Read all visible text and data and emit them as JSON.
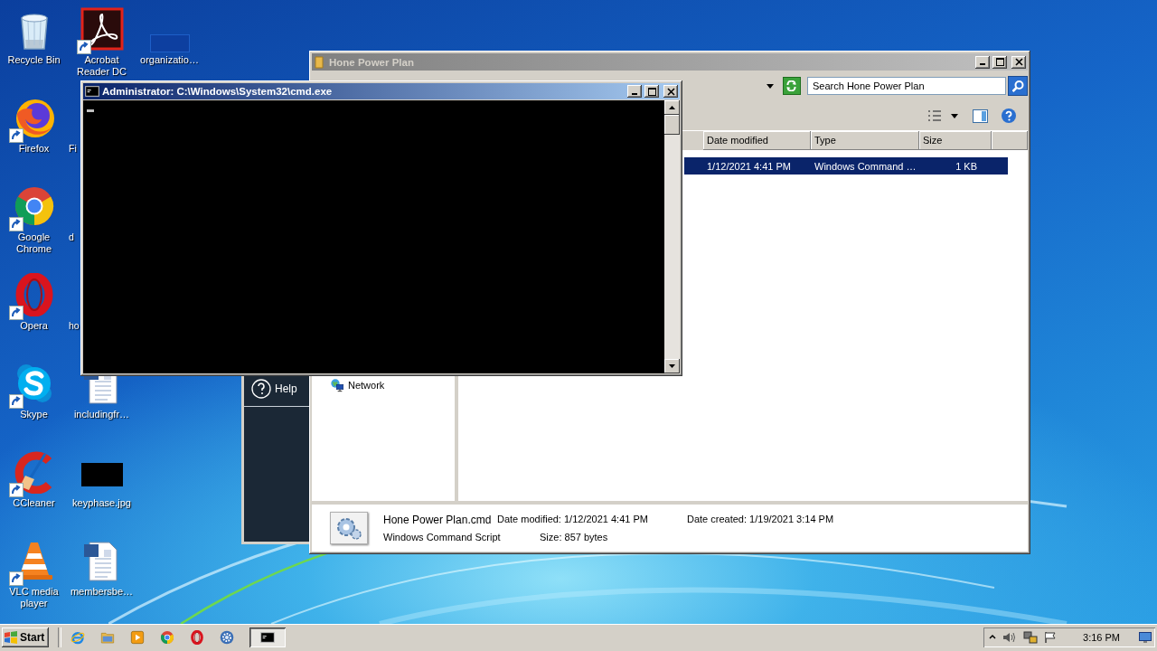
{
  "desktop_icon_columns": [
    [
      {
        "label": "Recycle Bin",
        "kind": "recycle",
        "shortcut": false
      },
      {
        "label": "Firefox",
        "kind": "firefox",
        "shortcut": true
      },
      {
        "label": "Google Chrome",
        "kind": "chrome",
        "shortcut": true
      },
      {
        "label": "Opera",
        "kind": "opera",
        "shortcut": true
      },
      {
        "label": "Skype",
        "kind": "skype",
        "shortcut": true
      },
      {
        "label": "CCleaner",
        "kind": "ccleaner",
        "shortcut": true
      },
      {
        "label": "VLC media player",
        "kind": "vlc",
        "shortcut": true
      }
    ],
    [
      {
        "label": "Acrobat Reader DC",
        "kind": "acrobat",
        "shortcut": true
      },
      {
        "label": "Fi",
        "kind": "covered"
      },
      {
        "label": "d",
        "kind": "covered"
      },
      {
        "label": "ho",
        "kind": "covered"
      },
      {
        "label": "includingfr…",
        "kind": "word",
        "shortcut": false
      },
      {
        "label": "keyphase.jpg",
        "kind": "image",
        "shortcut": false
      },
      {
        "label": "membersbe…",
        "kind": "word",
        "shortcut": false
      }
    ],
    [
      {
        "label": "organizatio…",
        "kind": "thumbnail",
        "shortcut": false
      }
    ]
  ],
  "help_window": {
    "label": "Help"
  },
  "explorer_window": {
    "title": "Hone Power Plan",
    "active": false,
    "search": {
      "placeholder": "Search Hone Power Plan"
    },
    "columns": [
      "Date modified",
      "Type",
      "Size"
    ],
    "rows": [
      {
        "date_modified": "1/12/2021 4:41 PM",
        "type": "Windows Command …",
        "size": "1 KB",
        "selected": true
      }
    ],
    "navigation": [
      {
        "label": "Network",
        "kind": "network"
      }
    ],
    "details": {
      "name": "Hone Power Plan.cmd",
      "date_modified": "Date modified: 1/12/2021 4:41 PM",
      "date_created": "Date created: 1/19/2021 3:14 PM",
      "type": "Windows Command Script",
      "size": "Size: 857 bytes"
    }
  },
  "cmd_window": {
    "title": "Administrator: C:\\Windows\\System32\\cmd.exe",
    "active": true
  },
  "taskbar": {
    "start": "Start",
    "apps": [
      {
        "kind": "ie",
        "active": false
      },
      {
        "kind": "folder",
        "active": false
      },
      {
        "kind": "media",
        "active": false
      },
      {
        "kind": "chrome",
        "active": false
      },
      {
        "kind": "opera",
        "active": false
      },
      {
        "kind": "gear",
        "active": false
      },
      {
        "kind": "cmd",
        "active": true
      }
    ],
    "clock": "3:16 PM"
  }
}
